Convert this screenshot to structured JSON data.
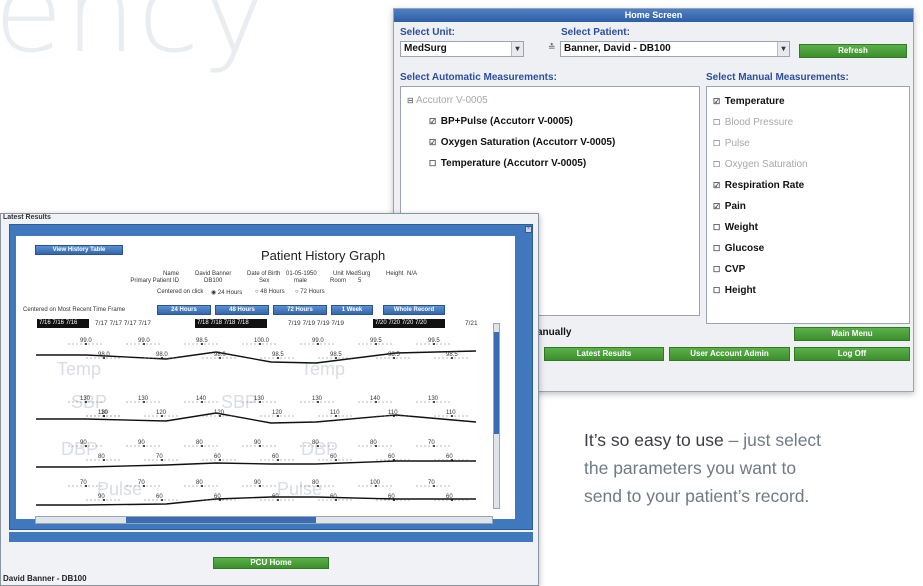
{
  "background_word": "ency",
  "home": {
    "title": "Home Screen",
    "select_unit_label": "Select Unit:",
    "unit_value": "MedSurg",
    "select_patient_label": "Select Patient:",
    "patient_value": "Banner, David - DB100",
    "refresh_label": "Refresh",
    "auto_label": "Select Automatic Measurements:",
    "manual_label": "Select Manual Measurements:",
    "device_item": "Accutorr V-0005",
    "auto_items": [
      {
        "label": "BP+Pulse (Accutorr V-0005)",
        "checked": true
      },
      {
        "label": "Oxygen Saturation (Accutorr V-0005)",
        "checked": true
      },
      {
        "label": "Temperature (Accutorr V-0005)",
        "checked": false
      }
    ],
    "manual_items": [
      {
        "label": "Temperature",
        "checked": true,
        "enabled": true
      },
      {
        "label": "Blood Pressure",
        "checked": false,
        "enabled": false
      },
      {
        "label": "Pulse",
        "checked": false,
        "enabled": false
      },
      {
        "label": "Oxygen Saturation",
        "checked": false,
        "enabled": false
      },
      {
        "label": "Respiration Rate",
        "checked": true,
        "enabled": true
      },
      {
        "label": "Pain",
        "checked": true,
        "enabled": true
      },
      {
        "label": "Weight",
        "checked": false,
        "enabled": true
      },
      {
        "label": "Glucose",
        "checked": false,
        "enabled": true
      },
      {
        "label": "CVP",
        "checked": false,
        "enabled": true
      },
      {
        "label": "Height",
        "checked": false,
        "enabled": true
      }
    ],
    "manually_text": "anually",
    "main_menu_label": "Main Menu",
    "latest_results_label": "Latest Results",
    "user_account_admin_label": "User Account Admin",
    "log_off_label": "Log Off"
  },
  "latest": {
    "title": "Latest Results",
    "view_history_label": "View History Table",
    "graph_title": "Patient History Graph",
    "name_label": "Name",
    "primary_id_label": "Primary Patient ID",
    "name_value": "David Banner",
    "id_value": "DB100",
    "dob_label": "Date of Birth",
    "dob_value": "01-05-1950",
    "sex_label": "Sex",
    "sex_value": "male",
    "unit_label": "Unit",
    "unit_value": "MedSurg",
    "room_label": "Room",
    "room_value": "5",
    "height_label": "Height",
    "height_value": "N/A",
    "centered_on_click": "Centered on click",
    "radio_24": "24 Hours",
    "radio_48": "48 Hours",
    "radio_72": "72 Hours",
    "centered_recent": "Centered on Most Recent Time Frame",
    "btn_24": "24 Hours",
    "btn_48": "48 Hours",
    "btn_72": "72 Hours",
    "btn_week": "1 Week",
    "btn_whole": "Whole Record",
    "date_bars": [
      "7/16 7/16 7/16",
      "7/17 7/17 7/17 7/17",
      "7/18 7/18 7/18 7/18",
      "7/19 7/19 7/19 7/19",
      "7/20 7/20 7/20 7/20",
      "7/21"
    ],
    "ghost_labels": [
      "Temp",
      "SBP",
      "DBP",
      "Pulse"
    ],
    "pcu_home_label": "PCU Home",
    "footer_name": "David Banner - DB100"
  },
  "graph_values": {
    "temp": [
      "99.0",
      "99.0",
      "98.5",
      "100.0",
      "99.0",
      "99.5",
      "99.5",
      "98.0",
      "98.0",
      "98.0",
      "98.5",
      "98.5",
      "98.5",
      "98.5"
    ],
    "sbp": [
      "130",
      "130",
      "140",
      "130",
      "130",
      "140",
      "130",
      "130",
      "120",
      "120",
      "120",
      "110",
      "110",
      "110",
      "110"
    ],
    "dbp": [
      "90",
      "90",
      "80",
      "90",
      "80",
      "80",
      "70",
      "80",
      "70",
      "60",
      "60",
      "60",
      "60",
      "60"
    ],
    "pulse": [
      "70",
      "70",
      "80",
      "90",
      "80",
      "100",
      "70",
      "90",
      "60",
      "60",
      "60",
      "60",
      "60",
      "60"
    ]
  },
  "caption": {
    "line1_dark": "It’s so easy to use",
    "line1_light": " – just select",
    "line2": "the parameters you want to",
    "line3": "send to your patient’s record."
  },
  "colors": {
    "blue_title": "#2a4fa0",
    "green_button": "#3c8f2d",
    "frame_blue": "#3f78bd"
  }
}
